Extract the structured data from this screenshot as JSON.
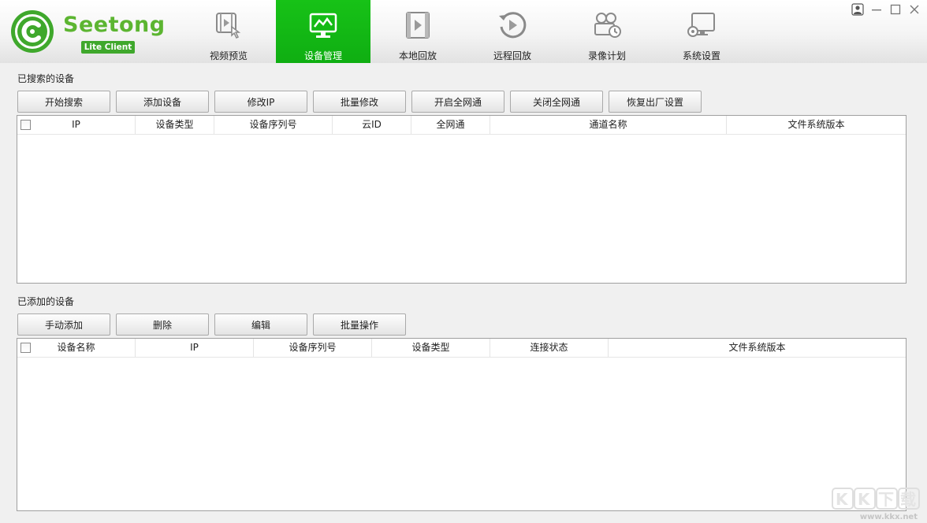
{
  "logo": {
    "name": "Seetong",
    "badge": "Lite Client"
  },
  "nav": [
    {
      "label": "视频预览",
      "icon": "video-preview-icon",
      "active": false
    },
    {
      "label": "设备管理",
      "icon": "device-management-icon",
      "active": true
    },
    {
      "label": "本地回放",
      "icon": "local-playback-icon",
      "active": false
    },
    {
      "label": "远程回放",
      "icon": "remote-playback-icon",
      "active": false
    },
    {
      "label": "录像计划",
      "icon": "recording-schedule-icon",
      "active": false
    },
    {
      "label": "系统设置",
      "icon": "system-settings-icon",
      "active": false
    }
  ],
  "window_controls": [
    "user-icon",
    "minimize-icon",
    "maximize-icon",
    "close-icon"
  ],
  "searched": {
    "title": "已搜索的设备",
    "buttons": [
      "开始搜索",
      "添加设备",
      "修改IP",
      "批量修改",
      "开启全网通",
      "关闭全网通",
      "恢复出厂设置"
    ],
    "columns": [
      "IP",
      "设备类型",
      "设备序列号",
      "云ID",
      "全网通",
      "通道名称",
      "文件系统版本"
    ],
    "rows": []
  },
  "added": {
    "title": "已添加的设备",
    "buttons": [
      "手动添加",
      "删除",
      "编辑",
      "批量操作"
    ],
    "columns": [
      "设备名称",
      "IP",
      "设备序列号",
      "设备类型",
      "连接状态",
      "文件系统版本"
    ],
    "rows": []
  },
  "watermark": {
    "logo": "KK下载",
    "url": "www.kkx.net"
  },
  "colors": {
    "accent": "#11b815",
    "logo_green": "#5cb531"
  }
}
